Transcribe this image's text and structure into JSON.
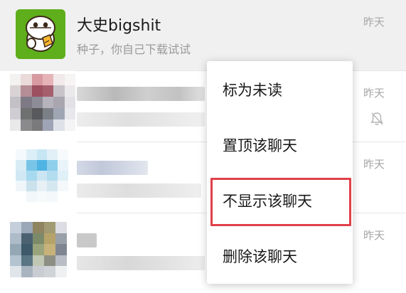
{
  "chats": [
    {
      "name": "大史bigshit",
      "preview": "种子，你自己下载试试",
      "time": "昨天",
      "avatar_icon": "cartoon-character-icon"
    },
    {
      "name": "",
      "preview": "",
      "time": "昨天",
      "muted": true
    },
    {
      "name": "",
      "preview": "",
      "time": "昨天"
    },
    {
      "name": "",
      "preview": "",
      "time": "昨天"
    }
  ],
  "context_menu": {
    "items": [
      {
        "label": "标为未读"
      },
      {
        "label": "置顶该聊天"
      },
      {
        "label": "不显示该聊天"
      },
      {
        "label": "删除该聊天"
      }
    ],
    "highlighted_index": 2,
    "highlight_color": "#e0404a"
  },
  "colors": {
    "active_row_bg": "#f0f0f0",
    "avatar_green": "#5fae1b",
    "secondary_text": "#9a9a9a"
  }
}
